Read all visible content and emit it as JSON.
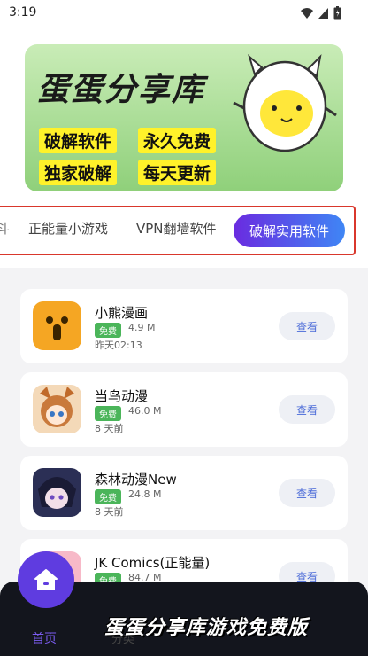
{
  "status": {
    "time": "3:19"
  },
  "banner": {
    "title": "蛋蛋分享库",
    "tags": [
      "破解软件",
      "永久免费",
      "独家破解",
      "每天更新"
    ]
  },
  "tabs": {
    "edge": "斗",
    "items": [
      "正能量小游戏",
      "VPN翻墙软件"
    ],
    "active": "破解实用软件"
  },
  "apps": [
    {
      "name": "小熊漫画",
      "badge": "免费",
      "size": "4.9 M",
      "date": "昨天02:13",
      "button": "查看"
    },
    {
      "name": "当鸟动漫",
      "badge": "免费",
      "size": "46.0 M",
      "date": "8 天前",
      "button": "查看"
    },
    {
      "name": "森林动漫New",
      "badge": "免费",
      "size": "24.8 M",
      "date": "8 天前",
      "button": "查看"
    },
    {
      "name": "JK Comics(正能量)",
      "badge": "免费",
      "size": "84.7 M",
      "date": "",
      "button": "查看"
    }
  ],
  "nav": {
    "home": "首页",
    "faded": "分类"
  },
  "watermark": "蛋蛋分享库游戏免费版",
  "colors": {
    "accent": "#5f3ce0",
    "tab_gradient_start": "#6a2be0",
    "tab_gradient_end": "#3f86f5",
    "badge": "#4bb55a"
  }
}
